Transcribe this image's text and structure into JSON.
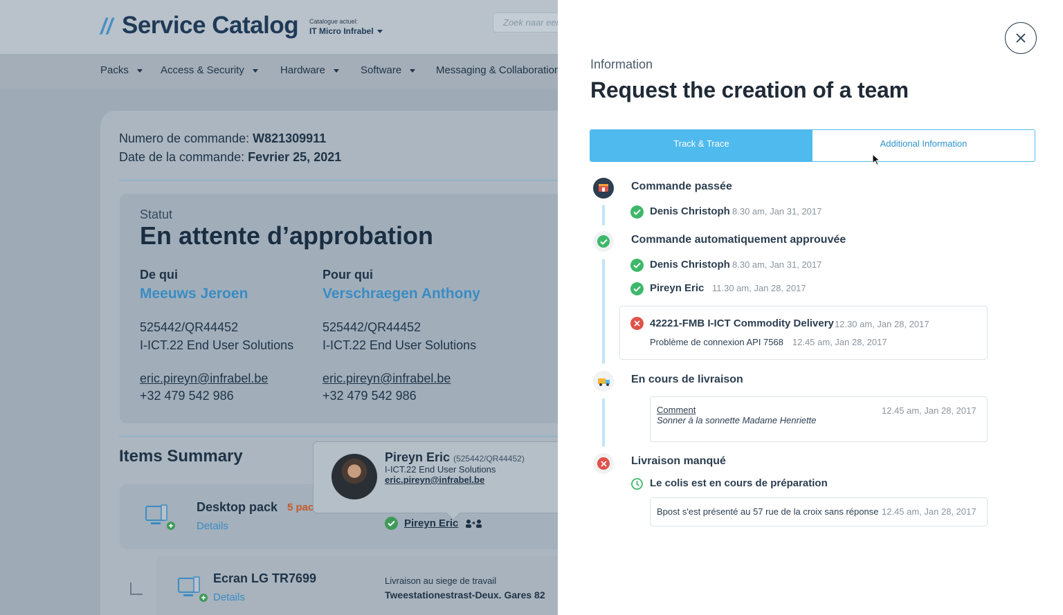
{
  "header": {
    "logo_slash": "//",
    "app_title": "Service Catalog",
    "catalogue_label": "Catalogue actuel:",
    "catalogue_value": "IT Micro Infrabel",
    "search_placeholder": "Zoek naar een"
  },
  "nav": {
    "items": [
      {
        "label": "Packs"
      },
      {
        "label": "Access & Security"
      },
      {
        "label": "Hardware"
      },
      {
        "label": "Software"
      },
      {
        "label": "Messaging & Collaboration"
      }
    ]
  },
  "order": {
    "number_label": "Numero de commande:",
    "number_value": "W821309911",
    "date_label": "Date de la commande:",
    "date_value": "Fevrier 25, 2021"
  },
  "status": {
    "label": "Statut",
    "value": "En attente d’approbation",
    "from": {
      "heading": "De qui",
      "name": "Meeuws Jeroen",
      "code": "525442/QR44452",
      "dept": "I-ICT.22 End User Solutions",
      "email": "eric.pireyn@infrabel.be",
      "phone": "+32 479 542 986"
    },
    "for": {
      "heading": "Pour qui",
      "name": "Verschraegen Anthony",
      "code": "525442/QR44452",
      "dept": "I-ICT.22 End User Solutions",
      "email": "eric.pireyn@infrabel.be",
      "phone": "+32 479 542 986"
    }
  },
  "items_summary": {
    "title": "Items Summary",
    "rows": [
      {
        "name": "Desktop pack",
        "count": "5 pac",
        "details": "Details",
        "owner": "Pireyn Eric"
      },
      {
        "name": "Ecran LG TR7699",
        "details": "Details",
        "delivery_label": "Livraison au siege de travail",
        "delivery_address": "Tweestationestrast-Deux. Gares 82"
      }
    ]
  },
  "popover": {
    "name": "Pireyn Eric",
    "code": "(525442/QR44452)",
    "dept": "I-ICT.22 End User Solutions",
    "email": "eric.pireyn@infrabel.be"
  },
  "panel": {
    "section_label": "Information",
    "title": "Request the creation of a team",
    "tabs": [
      {
        "label": "Track & Trace",
        "active": true
      },
      {
        "label": "Additional Information",
        "active": false
      }
    ],
    "colors": {
      "accent": "#4fbaee",
      "success": "#3db86a",
      "error": "#e0524a",
      "timeline": "#bfe5f6"
    },
    "timeline": {
      "stage1": {
        "title": "Commande passée",
        "icon": "shop-icon",
        "events": [
          {
            "name": "Denis Christoph",
            "time": "8.30 am, Jan 31, 2017",
            "status": "ok"
          }
        ]
      },
      "stage2": {
        "title": "Commande automatiquement approuvée",
        "icon": "check-icon",
        "events": [
          {
            "name": "Denis Christoph",
            "time": "8.30 am, Jan 31, 2017",
            "status": "ok"
          },
          {
            "name": "Pireyn Eric",
            "time": "11.30 am, Jan 28, 2017",
            "status": "ok"
          }
        ],
        "error_box": {
          "name": "42221-FMB I-ICT Commodity Delivery",
          "time": "12.30 am, Jan 28, 2017",
          "detail": "Problème de connexion API 7568",
          "detail_time": "12.45 am, Jan 28, 2017"
        }
      },
      "stage3": {
        "title": "En cours de livraison",
        "icon": "truck-icon",
        "comment": {
          "label": "Comment",
          "time": "12.45 am, Jan 28, 2017",
          "text": "Sonner à la sonnette Madame Henriette"
        }
      },
      "stage4": {
        "title": "Livraison manqué",
        "icon": "error-icon",
        "sub_title": "Le colis est en cours de préparation",
        "box_text": "Bpost s'est présenté au 57 rue de la croix sans réponse",
        "box_time": "12.45 am, Jan 28, 2017"
      }
    }
  }
}
